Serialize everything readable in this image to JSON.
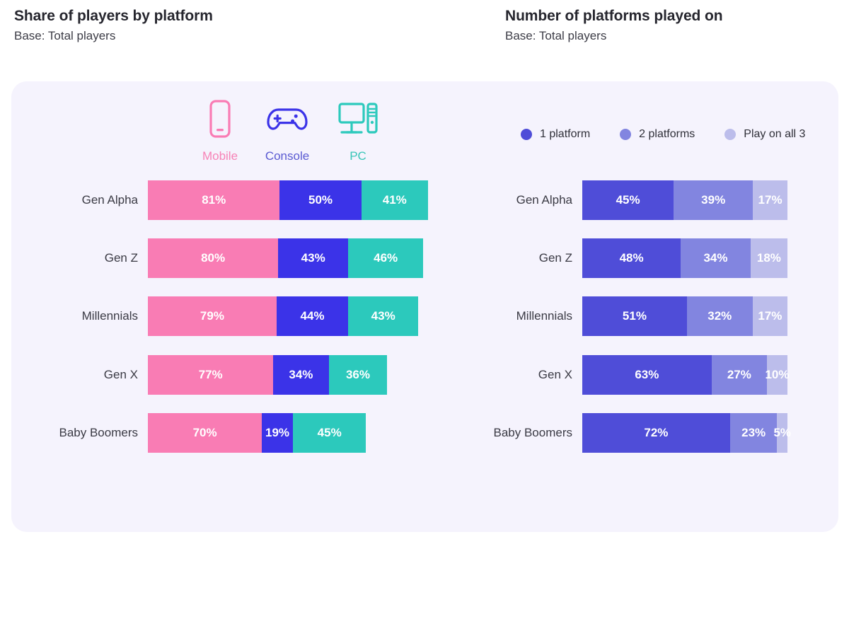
{
  "charts": [
    {
      "id": "share-of-players-by-platform",
      "title": "Share of players by platform",
      "subtitle": "Base: Total players",
      "platforms": [
        {
          "label": "Mobile",
          "icon": "mobile-phone-icon",
          "color": "#f97cb4"
        },
        {
          "label": "Console",
          "icon": "game-controller-icon",
          "color": "#3b33e8"
        },
        {
          "label": "PC",
          "icon": "desktop-computer-icon",
          "color": "#2cc9bc"
        }
      ],
      "chart_data": {
        "type": "bar",
        "title": "Share of players by platform",
        "subtitle": "Base: Total players",
        "stacked": true,
        "normalized": false,
        "orientation": "horizontal",
        "grid": false,
        "legend_position": "top",
        "xlabel": "",
        "ylabel": "",
        "value_suffix": "%",
        "categories": [
          "Gen Alpha",
          "Gen Z",
          "Millennials",
          "Gen X",
          "Baby Boomers"
        ],
        "series": [
          {
            "name": "Mobile",
            "color": "#f97cb4",
            "values": [
              81,
              80,
              79,
              77,
              70
            ]
          },
          {
            "name": "Console",
            "color": "#3b33e8",
            "values": [
              50,
              43,
              44,
              34,
              19
            ]
          },
          {
            "name": "PC",
            "color": "#2cc9bc",
            "values": [
              41,
              46,
              43,
              36,
              45
            ]
          }
        ]
      }
    },
    {
      "id": "number-of-platforms-played-on",
      "title": "Number of platforms played on",
      "subtitle": "Base: Total players",
      "legend": [
        {
          "label": "1 platform",
          "color": "#4f4dd8"
        },
        {
          "label": "2 platforms",
          "color": "#8285e0"
        },
        {
          "label": "Play on all 3",
          "color": "#bcbdeb"
        }
      ],
      "chart_data": {
        "type": "bar",
        "title": "Number of platforms played on",
        "subtitle": "Base: Total players",
        "stacked": true,
        "normalized": true,
        "orientation": "horizontal",
        "grid": false,
        "legend_position": "top",
        "xlabel": "",
        "ylabel": "",
        "value_suffix": "%",
        "xlim": [
          0,
          100
        ],
        "categories": [
          "Gen Alpha",
          "Gen Z",
          "Millennials",
          "Gen X",
          "Baby Boomers"
        ],
        "series": [
          {
            "name": "1 platform",
            "color": "#4f4dd8",
            "values": [
              45,
              48,
              51,
              63,
              72
            ]
          },
          {
            "name": "2 platforms",
            "color": "#8285e0",
            "values": [
              39,
              34,
              32,
              27,
              23
            ]
          },
          {
            "name": "Play on all 3",
            "color": "#bcbdeb",
            "values": [
              17,
              18,
              17,
              10,
              5
            ]
          }
        ]
      }
    }
  ]
}
